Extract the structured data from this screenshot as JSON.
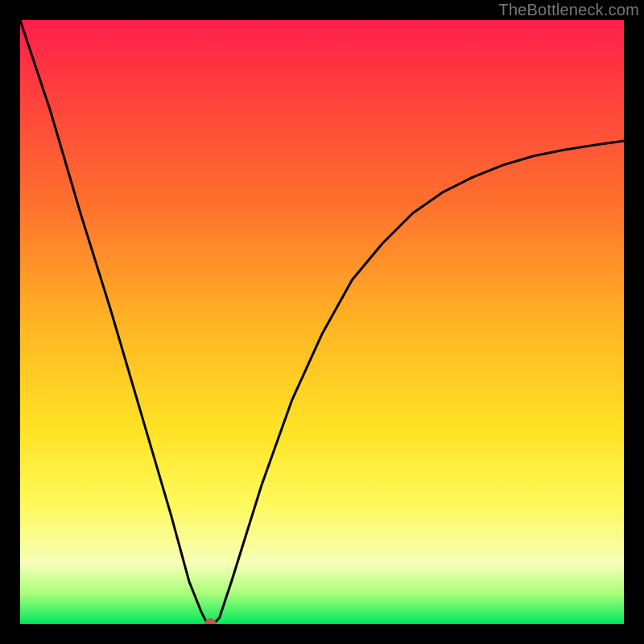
{
  "attribution": "TheBottleneck.com",
  "chart_data": {
    "type": "line",
    "title": "",
    "xlabel": "",
    "ylabel": "",
    "xlim": [
      0,
      100
    ],
    "ylim": [
      0,
      100
    ],
    "x": [
      0,
      5,
      10,
      15,
      20,
      25,
      28,
      30,
      31,
      32,
      33,
      35,
      40,
      45,
      50,
      55,
      60,
      65,
      70,
      75,
      80,
      85,
      90,
      95,
      100
    ],
    "values": [
      100,
      85,
      68,
      52,
      35,
      18,
      7,
      2,
      0,
      0,
      1,
      7,
      23,
      37,
      48,
      57,
      63,
      68,
      71.5,
      74,
      76,
      77.5,
      78.5,
      79.3,
      80
    ],
    "min_point": {
      "x": 31.5,
      "y": 0
    },
    "colors": {
      "curve": "#000000",
      "marker": "#c05a4a",
      "gradient_top": "#ff1f4b",
      "gradient_bottom": "#00e85d"
    }
  }
}
